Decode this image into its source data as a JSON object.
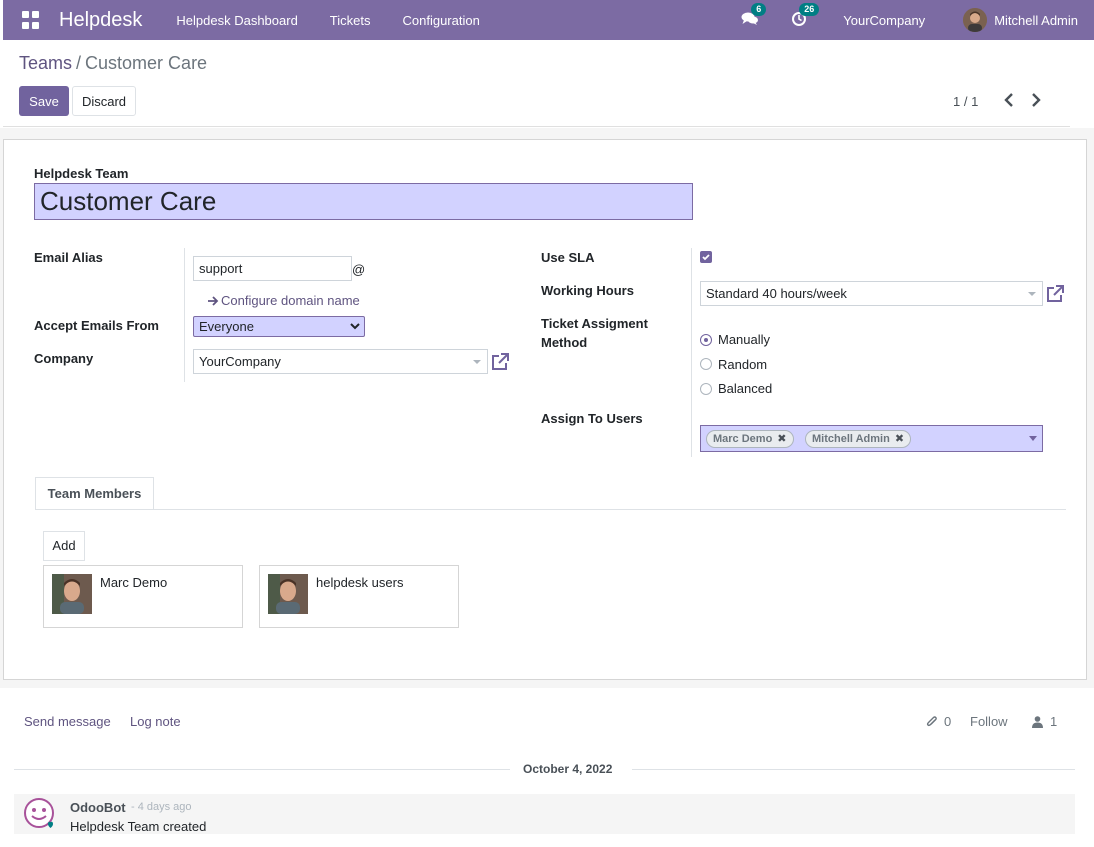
{
  "navbar": {
    "app_name": "Helpdesk",
    "menu": [
      "Helpdesk Dashboard",
      "Tickets",
      "Configuration"
    ],
    "messages_count": "6",
    "activities_count": "26",
    "company": "YourCompany",
    "user": "Mitchell Admin",
    "color": "#7c6ba3"
  },
  "breadcrumb": {
    "parent": "Teams",
    "separator": "/",
    "current": "Customer Care"
  },
  "buttons": {
    "save": "Save",
    "discard": "Discard",
    "add": "Add"
  },
  "pager": {
    "text": "1 / 1"
  },
  "form": {
    "team_label": "Helpdesk Team",
    "team_name": "Customer Care",
    "email_alias_label": "Email Alias",
    "email_alias_value": "support",
    "at_sign": "@",
    "configure_domain": "Configure domain name",
    "accept_emails_label": "Accept Emails From",
    "accept_emails_value": "Everyone",
    "company_label": "Company",
    "company_value": "YourCompany",
    "use_sla_label": "Use SLA",
    "use_sla_checked": true,
    "working_hours_label": "Working Hours",
    "working_hours_value": "Standard 40 hours/week",
    "assignment_label_line1": "Ticket Assigment",
    "assignment_label_line2": "Method",
    "assignment_options": [
      "Manually",
      "Random",
      "Balanced"
    ],
    "assignment_selected": "Manually",
    "assign_users_label": "Assign To Users",
    "assigned_users": [
      "Marc Demo",
      "Mitchell Admin"
    ]
  },
  "tabs": {
    "team_members": "Team Members"
  },
  "team_members": [
    {
      "name": "Marc Demo"
    },
    {
      "name": "helpdesk users"
    }
  ],
  "chatter": {
    "send_message": "Send message",
    "log_note": "Log note",
    "attachments_count": "0",
    "follow": "Follow",
    "followers_count": "1",
    "date_separator": "October 4, 2022",
    "message": {
      "author": "OdooBot",
      "date": "- 4 days ago",
      "body": "Helpdesk Team created"
    }
  },
  "colors": {
    "primary": "#71639e",
    "highlight_field": "#d2d2ff",
    "badge": "#017e84"
  }
}
